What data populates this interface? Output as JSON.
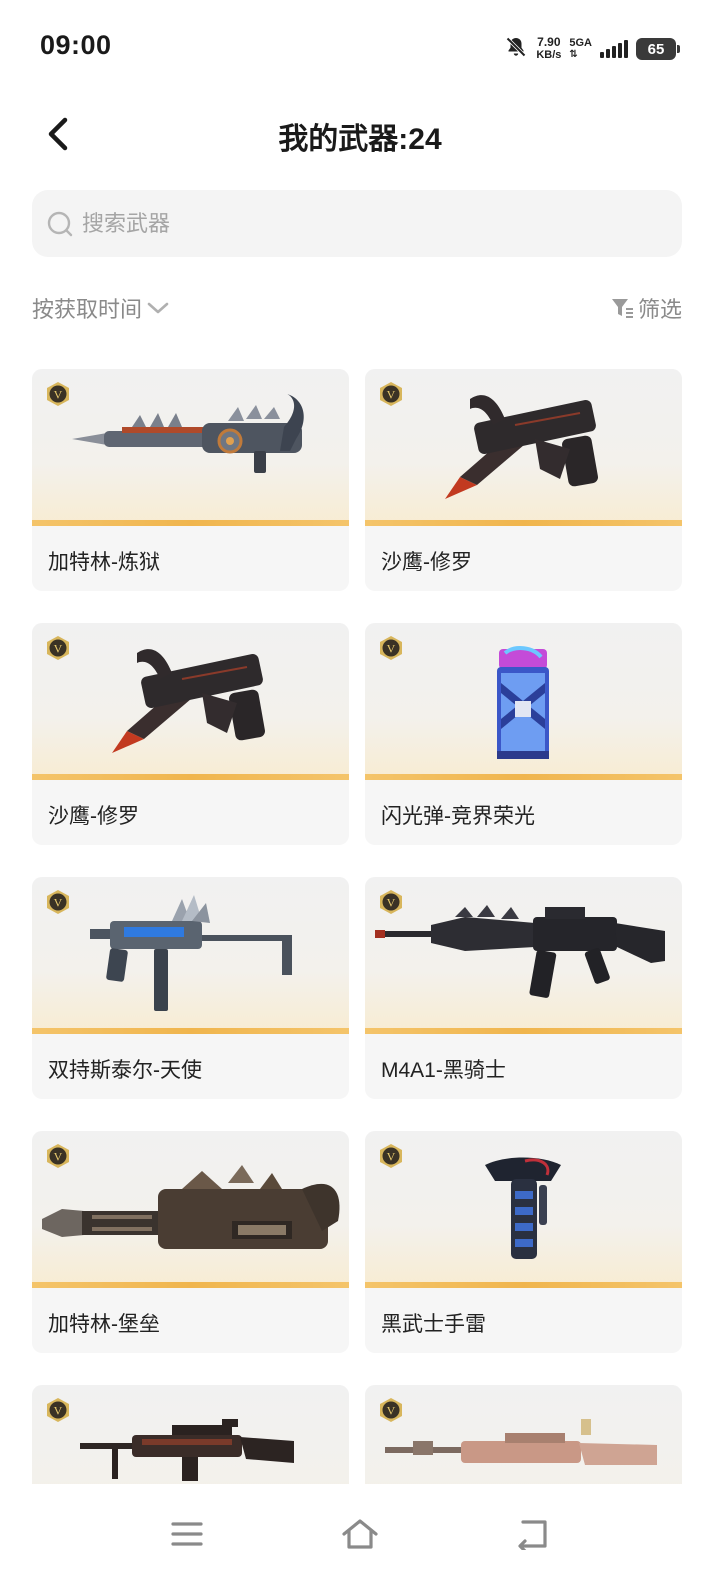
{
  "status_bar": {
    "time": "09:00",
    "net_speed_value": "7.90",
    "net_speed_unit": "KB/s",
    "network_type": "5GA",
    "battery_level": "65",
    "icons": [
      "bell-muted-icon",
      "signal-icon",
      "battery-icon"
    ]
  },
  "header": {
    "title": "我的武器:24",
    "back_icon": "chevron-left-icon"
  },
  "search": {
    "placeholder": "搜索武器",
    "value": ""
  },
  "sort": {
    "label": "按获取时间",
    "icon": "chevron-down-icon"
  },
  "filter": {
    "label": "筛选",
    "icon": "filter-icon"
  },
  "weapons": [
    {
      "name": "加特林-炼狱",
      "badge": "V"
    },
    {
      "name": "沙鹰-修罗",
      "badge": "V"
    },
    {
      "name": "沙鹰-修罗",
      "badge": "V"
    },
    {
      "name": "闪光弹-竞界荣光",
      "badge": "V"
    },
    {
      "name": "双持斯泰尔-天使",
      "badge": "V"
    },
    {
      "name": "M4A1-黑骑士",
      "badge": "V"
    },
    {
      "name": "加特林-堡垒",
      "badge": "V"
    },
    {
      "name": "黑武士手雷",
      "badge": "V"
    },
    {
      "name": "",
      "badge": "V"
    },
    {
      "name": "",
      "badge": "V"
    }
  ],
  "nav": {
    "icons": [
      "menu-icon",
      "home-icon",
      "back-icon"
    ]
  },
  "colors": {
    "card_accent": "#f0b54d",
    "badge_gold": "#c9a24a",
    "text_secondary": "#8a8a8a"
  }
}
